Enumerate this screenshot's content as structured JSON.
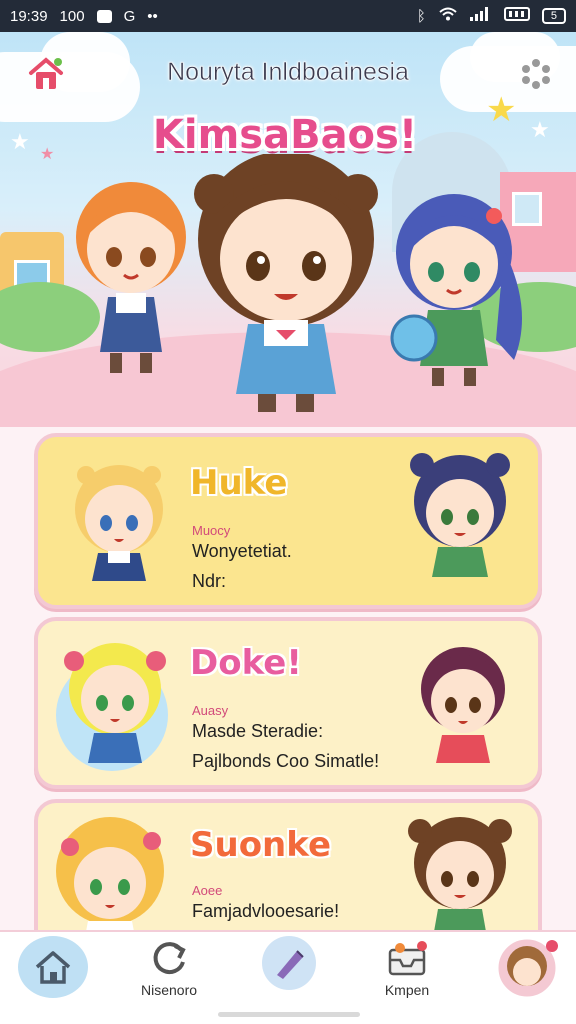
{
  "status_bar": {
    "time": "19:39",
    "battery_pct": "100",
    "battery_label": "5"
  },
  "header": {
    "app_title": "Nouryta Inldboainesia",
    "logo_text": "KimsaBaos!",
    "home_icon": "home-icon",
    "menu_icon": "dots-menu-icon"
  },
  "cards": [
    {
      "name": "Huke",
      "name_color": "#f0b62a",
      "sub": "Muocy",
      "line1": "Wonyetetiat.",
      "line2": "Ndr:"
    },
    {
      "name": "Doke!",
      "name_color": "#e85d9f",
      "sub": "Auasy",
      "line1": "Masde Steradie:",
      "line2": "Pajlbonds Coo Simatle!"
    },
    {
      "name": "Suonke",
      "name_color": "#f26a3b",
      "sub": "Aoee",
      "line1": "Famjadvlooesarie!",
      "line2": ""
    }
  ],
  "tabbar": {
    "tabs": [
      {
        "label": "",
        "icon": "home-icon"
      },
      {
        "label": "Nisenoro",
        "icon": "refresh-icon"
      },
      {
        "label": "",
        "icon": "pen-icon"
      },
      {
        "label": "Kmpen",
        "icon": "inbox-icon"
      },
      {
        "label": "",
        "icon": "avatar-icon"
      }
    ]
  },
  "colors": {
    "accent": "#e64d8d",
    "card_yellow": "#fbe58f",
    "card_cream": "#fdf1c7",
    "sky": "#bfe4f7"
  }
}
